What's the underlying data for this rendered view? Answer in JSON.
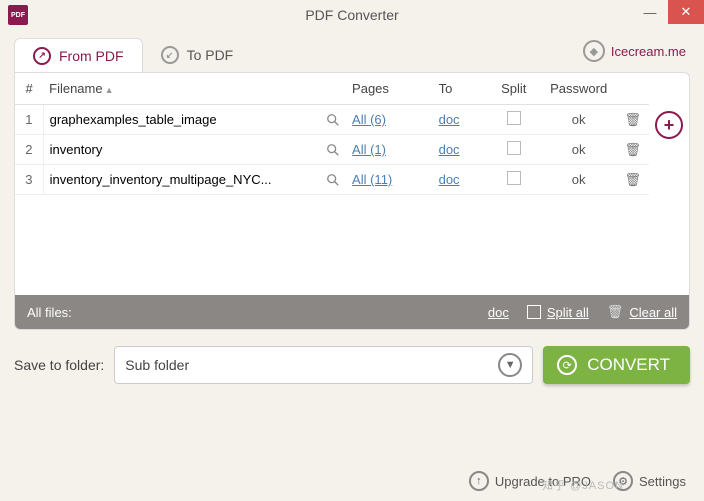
{
  "titlebar": {
    "app_name": "PDF",
    "title": "PDF Converter"
  },
  "tabs": {
    "from": "From PDF",
    "to": "To PDF"
  },
  "brand": "Icecream.me",
  "columns": {
    "num": "#",
    "filename": "Filename",
    "pages": "Pages",
    "to": "To",
    "split": "Split",
    "password": "Password"
  },
  "rows": [
    {
      "n": "1",
      "name": "graphexamples_table_image",
      "pages": "All (6)",
      "to": "doc",
      "pwd": "ok"
    },
    {
      "n": "2",
      "name": "inventory",
      "pages": "All (1)",
      "to": "doc",
      "pwd": "ok"
    },
    {
      "n": "3",
      "name": "inventory_inventory_multipage_NYC...",
      "pages": "All (11)",
      "to": "doc",
      "pwd": "ok"
    }
  ],
  "footer": {
    "all_files": "All files:",
    "to": "doc",
    "split_all": "Split all",
    "clear_all": "Clear all"
  },
  "save": {
    "label": "Save to folder:",
    "value": "Sub folder"
  },
  "convert": "CONVERT",
  "bottom": {
    "upgrade": "Upgrade to PRO",
    "settings": "Settings"
  },
  "watermark": "知乎 @JASON"
}
